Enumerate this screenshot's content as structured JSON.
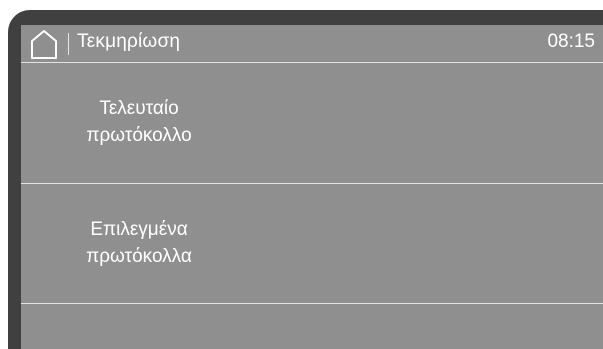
{
  "header": {
    "title": "Τεκμηρίωση",
    "time": "08:15",
    "home_icon": "home-icon"
  },
  "menu": {
    "items": [
      {
        "line1": "Τελευταίο",
        "line2": "πρωτόκολλο"
      },
      {
        "line1": "Επιλεγμένα",
        "line2": "πρωτόκολλα"
      }
    ]
  },
  "colors": {
    "bezel": "#404040",
    "screen": "#8f8f8f",
    "text": "#ffffff",
    "divider": "#e3e3e3"
  }
}
